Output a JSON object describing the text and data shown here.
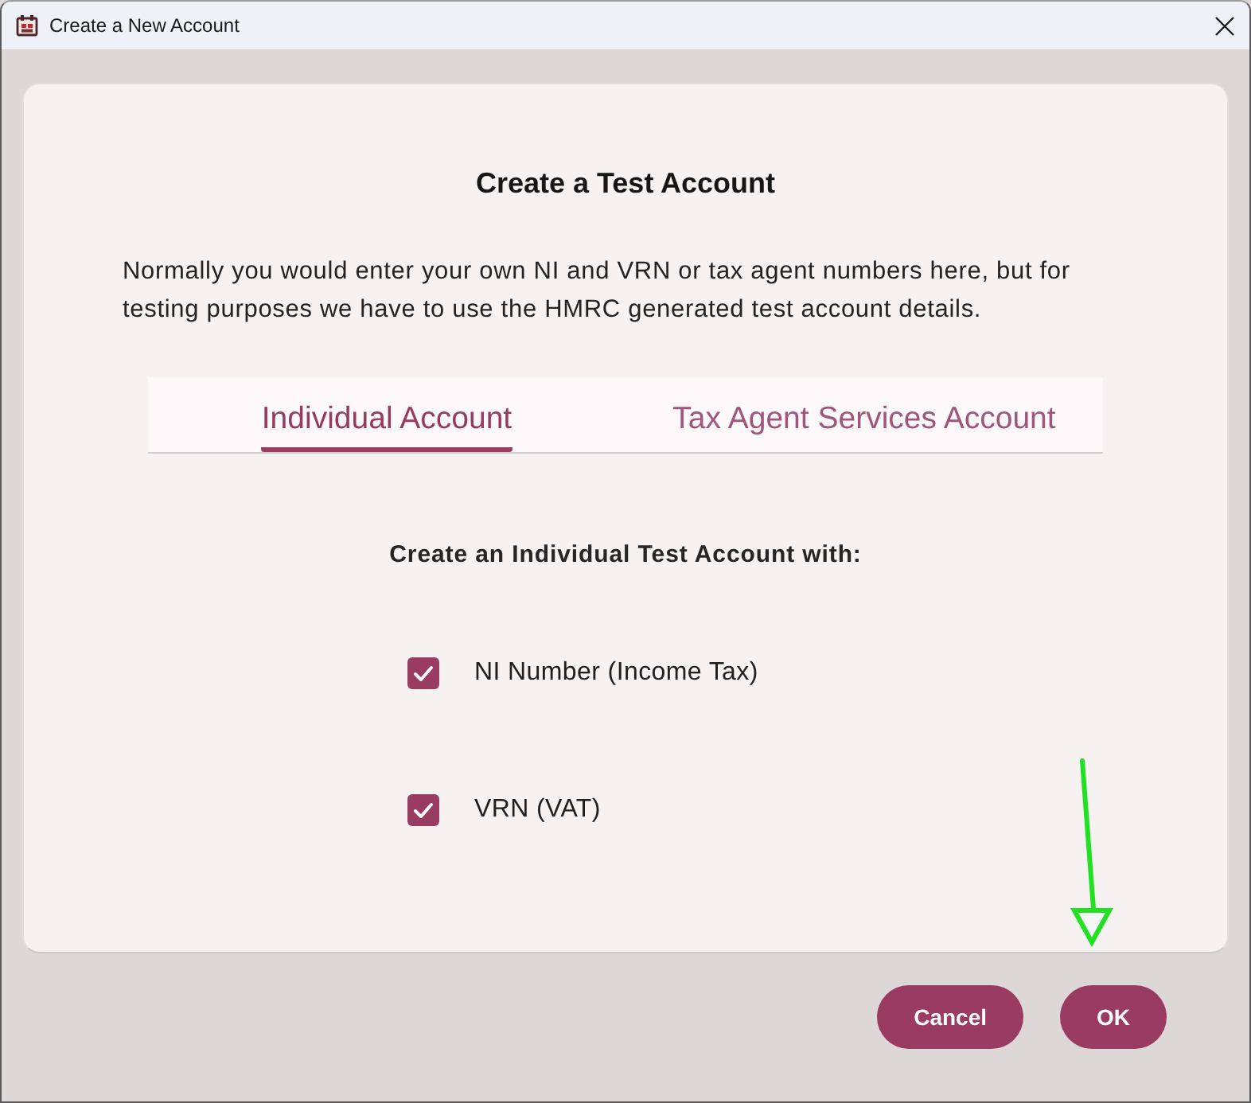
{
  "window": {
    "title": "Create a New Account"
  },
  "heading": "Create a Test Account",
  "description": "Normally you would enter your own NI and VRN or tax agent numbers here, but for testing purposes we have to use the HMRC generated test account details.",
  "tabs": [
    {
      "label": "Individual Account",
      "selected": true
    },
    {
      "label": "Tax Agent Services Account",
      "selected": false
    }
  ],
  "section_label": "Create an Individual Test Account with:",
  "options": [
    {
      "label": "NI Number (Income Tax)",
      "checked": true
    },
    {
      "label": "VRN (VAT)",
      "checked": true
    }
  ],
  "buttons": [
    "Cancel",
    "OK"
  ]
}
